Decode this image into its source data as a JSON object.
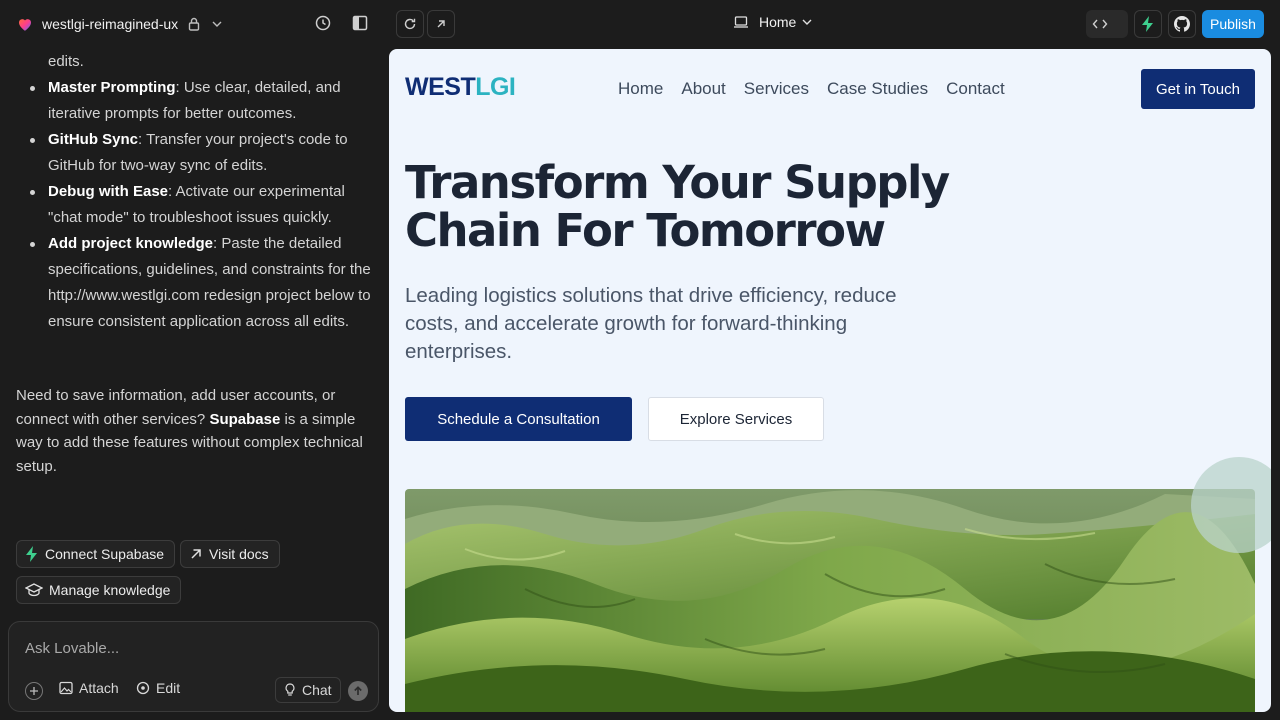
{
  "topbar": {
    "project_name": "westlgi-reimagined-ux",
    "route": "Home",
    "publish_label": "Publish"
  },
  "chat": {
    "bullets": [
      {
        "bold": "",
        "text": "edits."
      },
      {
        "bold": "Master Prompting",
        "text": ": Use clear, detailed, and iterative prompts for better outcomes."
      },
      {
        "bold": "GitHub Sync",
        "text": ": Transfer your project's code to GitHub for two-way sync of edits."
      },
      {
        "bold": "Debug with Ease",
        "text": ": Activate our experimental \"chat mode\" to troubleshoot issues quickly."
      },
      {
        "bold": "Add project knowledge",
        "text": ": Paste the detailed specifications, guidelines, and constraints for the http://www.westlgi.com redesign project below to ensure consistent application across all edits."
      }
    ],
    "supabase_para": {
      "before": "Need to save information, add user accounts, or connect with other services? ",
      "bold": "Supabase",
      "after": " is a simple way to add these features without complex technical setup."
    },
    "actions": {
      "connect_supabase": "Connect Supabase",
      "visit_docs": "Visit docs",
      "manage_knowledge": "Manage knowledge"
    },
    "composer": {
      "placeholder": "Ask Lovable...",
      "attach": "Attach",
      "edit": "Edit",
      "chat": "Chat"
    }
  },
  "site": {
    "logo_part1": "WEST",
    "logo_part2": "LGI",
    "nav": [
      "Home",
      "About",
      "Services",
      "Case Studies",
      "Contact"
    ],
    "cta_top": "Get in Touch",
    "hero_title_line1": "Transform Your Supply",
    "hero_title_line2": "Chain For Tomorrow",
    "hero_sub": "Leading logistics solutions that drive efficiency, reduce costs, and accelerate growth for forward-thinking enterprises.",
    "btn_primary": "Schedule a Consultation",
    "btn_secondary": "Explore Services"
  },
  "colors": {
    "brand_navy": "#0f2d74",
    "brand_teal": "#2cb3c1",
    "publish_blue": "#1a8ce0",
    "supabase_green": "#3ecf8e"
  }
}
